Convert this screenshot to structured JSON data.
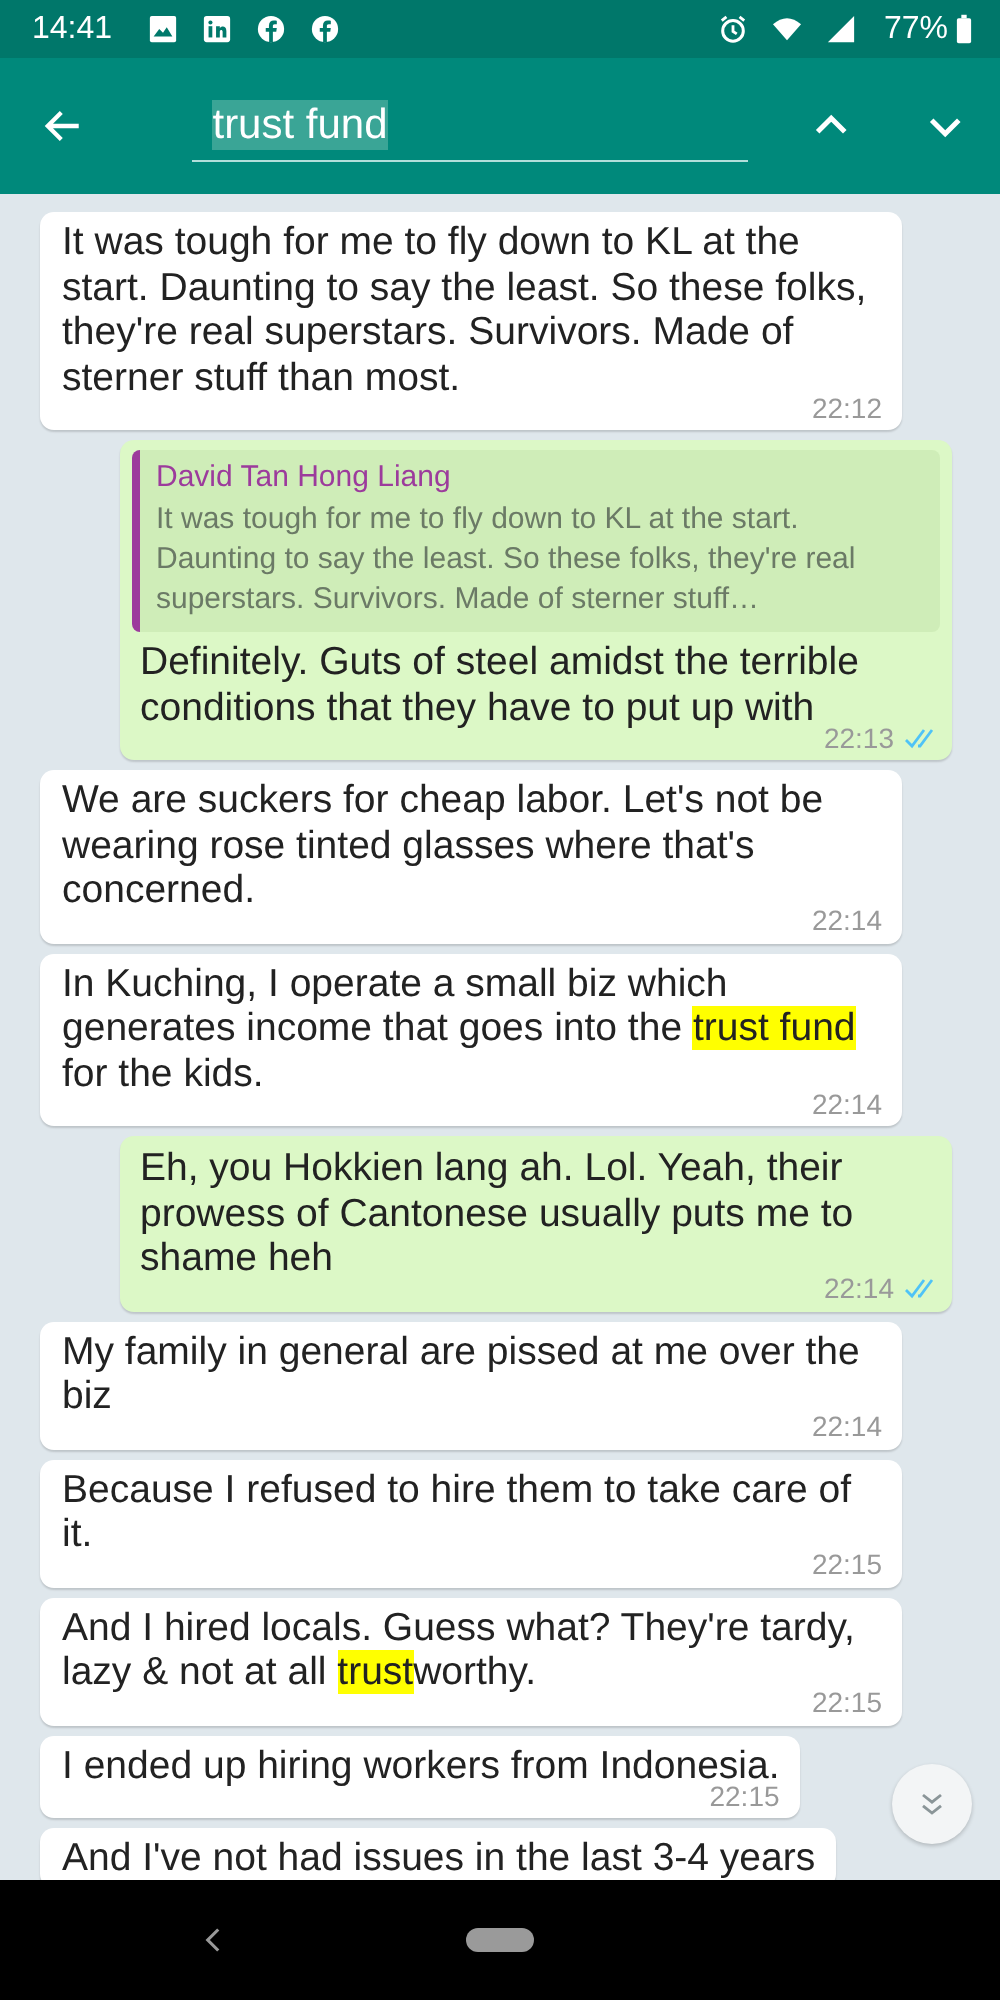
{
  "status_bar": {
    "time": "14:41",
    "battery": "77%"
  },
  "search": {
    "value": "trust fund"
  },
  "messages": [
    {
      "kind": "incoming",
      "parts": [
        {
          "text": "It was tough for me to fly down to KL at the start. Daunting to say the least. So these folks, they're real superstars. Survivors. Made of sterner stuff than most.",
          "highlight": false
        }
      ],
      "time": "22:12"
    },
    {
      "kind": "outgoing",
      "quote": {
        "author": "David Tan Hong Liang",
        "text": "It was tough for me to fly down to KL at the start. Daunting to say the least. So these folks, they're real superstars. Survivors. Made of sterner stuff…"
      },
      "parts": [
        {
          "text": "Definitely. Guts of steel amidst the terrible conditions that they have to put up with",
          "highlight": false
        }
      ],
      "time": "22:13",
      "read": true
    },
    {
      "kind": "incoming",
      "parts": [
        {
          "text": "We are suckers for cheap labor. Let's not be wearing rose tinted glasses where that's concerned.",
          "highlight": false
        }
      ],
      "time": "22:14"
    },
    {
      "kind": "incoming",
      "parts": [
        {
          "text": "In Kuching, I operate a small biz which generates income that goes into the ",
          "highlight": false
        },
        {
          "text": "trust fund",
          "highlight": true
        },
        {
          "text": " for the kids.",
          "highlight": false
        }
      ],
      "time": "22:14"
    },
    {
      "kind": "outgoing",
      "parts": [
        {
          "text": "Eh, you Hokkien lang ah. Lol. Yeah, their prowess of Cantonese usually puts me to shame heh",
          "highlight": false
        }
      ],
      "time": "22:14",
      "read": true
    },
    {
      "kind": "incoming",
      "parts": [
        {
          "text": "My family in general are pissed at me over the biz",
          "highlight": false
        }
      ],
      "time": "22:14"
    },
    {
      "kind": "incoming",
      "parts": [
        {
          "text": "Because I refused to hire them to take care of it.",
          "highlight": false
        }
      ],
      "time": "22:15"
    },
    {
      "kind": "incoming",
      "parts": [
        {
          "text": "And I hired locals. Guess what? They're tardy, lazy & not at all ",
          "highlight": false
        },
        {
          "text": "trust",
          "highlight": true
        },
        {
          "text": "worthy.",
          "highlight": false
        }
      ],
      "time": "22:15"
    },
    {
      "kind": "incoming",
      "parts": [
        {
          "text": "I ended up hiring workers from Indonesia.",
          "highlight": false
        }
      ],
      "time": "22:15"
    },
    {
      "kind": "incoming",
      "parts": [
        {
          "text": "And I've not had issues in the last 3-4 years",
          "highlight": false
        }
      ]
    }
  ]
}
